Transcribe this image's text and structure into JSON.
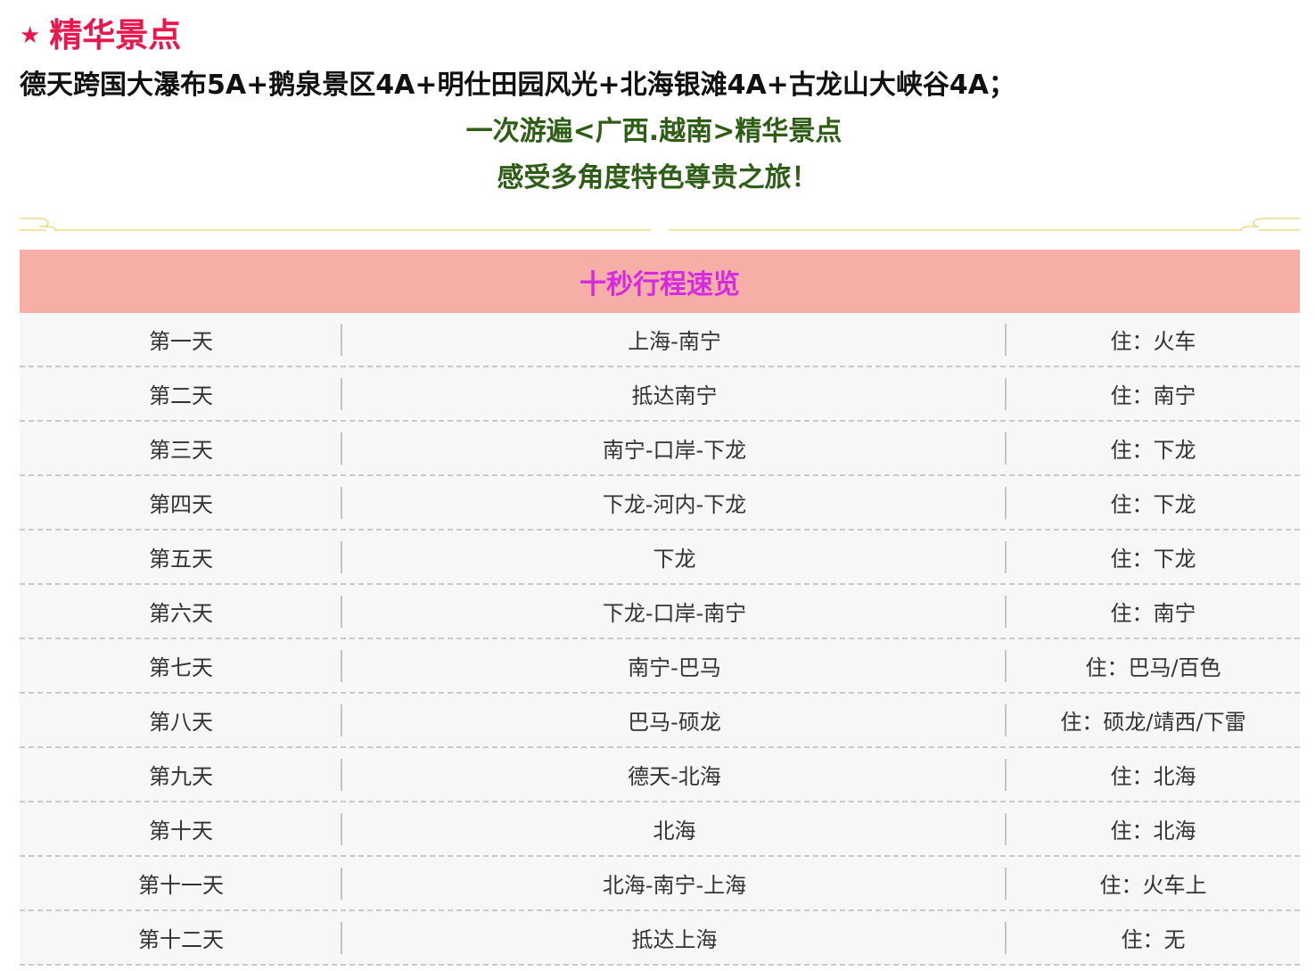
{
  "section": {
    "star": "★",
    "title": "精华景点"
  },
  "headline": "德天跨国大瀑布5A+鹅泉景区4A+明仕田园风光+北海银滩4A+古龙山大峡谷4A；",
  "slogan": {
    "line1": "一次游遍<广西.越南>精华景点",
    "line2": "感受多角度特色尊贵之旅！"
  },
  "colors": {
    "title": "#e8174d",
    "slogan": "#2e5e15",
    "header_bg": "#f7aea6",
    "header_text": "#d42be0",
    "divider": "#f2d88a"
  },
  "itinerary": {
    "title": "十秒行程速览",
    "rows": [
      {
        "day": "第一天",
        "route": "上海-南宁",
        "stay": "住：火车"
      },
      {
        "day": "第二天",
        "route": "抵达南宁",
        "stay": "住：南宁"
      },
      {
        "day": "第三天",
        "route": "南宁-口岸-下龙",
        "stay": "住：下龙"
      },
      {
        "day": "第四天",
        "route": "下龙-河内-下龙",
        "stay": "住：下龙"
      },
      {
        "day": "第五天",
        "route": "下龙",
        "stay": "住：下龙"
      },
      {
        "day": "第六天",
        "route": "下龙-口岸-南宁",
        "stay": "住：南宁"
      },
      {
        "day": "第七天",
        "route": "南宁-巴马",
        "stay": "住：巴马/百色"
      },
      {
        "day": "第八天",
        "route": "巴马-硕龙",
        "stay": "住：硕龙/靖西/下雷"
      },
      {
        "day": "第九天",
        "route": "德天-北海",
        "stay": "住：北海"
      },
      {
        "day": "第十天",
        "route": "北海",
        "stay": "住：北海"
      },
      {
        "day": "第十一天",
        "route": "北海-南宁-上海",
        "stay": "住：火车上"
      },
      {
        "day": "第十二天",
        "route": "抵达上海",
        "stay": "住：无"
      }
    ]
  }
}
